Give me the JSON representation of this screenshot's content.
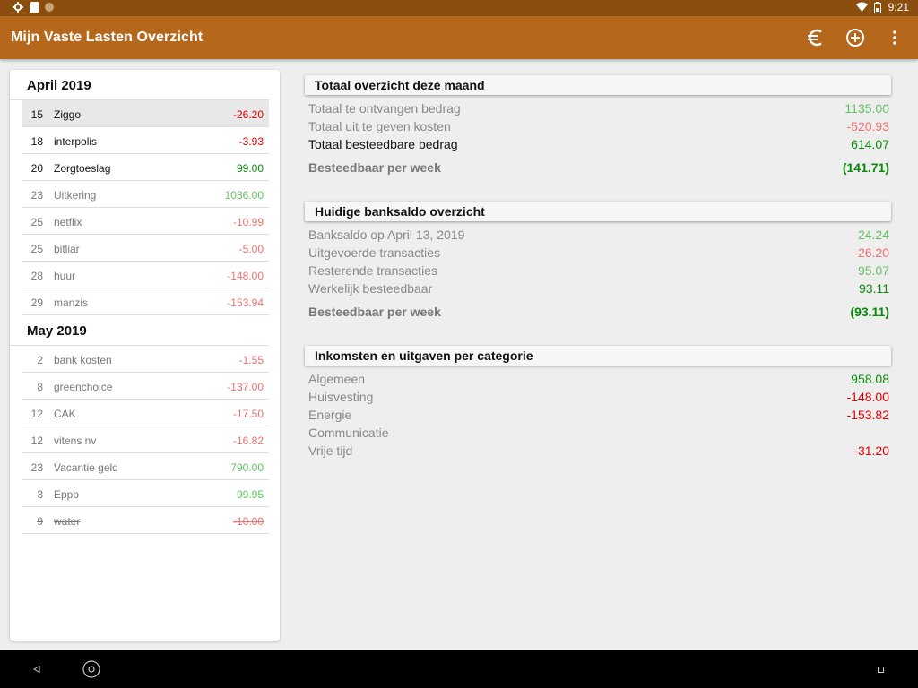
{
  "status_bar": {
    "time": "9:21",
    "icons": [
      "settings-icon",
      "sd-card-icon",
      "notification-dot-icon",
      "wifi-icon",
      "battery-icon"
    ]
  },
  "app_bar": {
    "title": "Mijn Vaste Lasten Overzicht",
    "actions": [
      "euro-icon",
      "add-circle-icon",
      "more-vert-icon"
    ]
  },
  "transactions": [
    {
      "month": "April 2019",
      "items": [
        {
          "day": "15",
          "name": "Ziggo",
          "amount": "-26.20",
          "state": "current",
          "tone": "neg",
          "selected": true
        },
        {
          "day": "18",
          "name": "interpolis",
          "amount": "-3.93",
          "state": "current",
          "tone": "neg"
        },
        {
          "day": "20",
          "name": "Zorgtoeslag",
          "amount": "99.00",
          "state": "current",
          "tone": "pos"
        },
        {
          "day": "23",
          "name": "Uitkering",
          "amount": "1036.00",
          "state": "future",
          "tone": "pos-light"
        },
        {
          "day": "25",
          "name": "netflix",
          "amount": "-10.99",
          "state": "future",
          "tone": "neg-light"
        },
        {
          "day": "25",
          "name": "bitliar",
          "amount": "-5.00",
          "state": "future",
          "tone": "neg-light"
        },
        {
          "day": "28",
          "name": "huur",
          "amount": "-148.00",
          "state": "future",
          "tone": "neg-light"
        },
        {
          "day": "29",
          "name": "manzis",
          "amount": "-153.94",
          "state": "future",
          "tone": "neg-light"
        }
      ]
    },
    {
      "month": "May 2019",
      "items": [
        {
          "day": "2",
          "name": "bank kosten",
          "amount": "-1.55",
          "state": "future",
          "tone": "neg-light"
        },
        {
          "day": "8",
          "name": "greenchoice",
          "amount": "-137.00",
          "state": "future",
          "tone": "neg-light"
        },
        {
          "day": "12",
          "name": "CAK",
          "amount": "-17.50",
          "state": "future",
          "tone": "neg-light"
        },
        {
          "day": "12",
          "name": "vitens nv",
          "amount": "-16.82",
          "state": "future",
          "tone": "neg-light"
        },
        {
          "day": "23",
          "name": "Vacantie geld",
          "amount": "790.00",
          "state": "future",
          "tone": "pos-light"
        },
        {
          "day": "3",
          "name": "Eppo",
          "amount": "99.95",
          "state": "done",
          "tone": "pos-light"
        },
        {
          "day": "9",
          "name": "water",
          "amount": "-10.00",
          "state": "done",
          "tone": "neg-light"
        }
      ]
    }
  ],
  "sections": [
    {
      "title": "Totaal overzicht deze maand",
      "rows": [
        {
          "label": "Totaal te ontvangen bedrag",
          "value": "1135.00",
          "style": "muted",
          "tone": "pos-light"
        },
        {
          "label": "Totaal uit te geven kosten",
          "value": "-520.93",
          "style": "muted",
          "tone": "neg-light"
        },
        {
          "label": "Totaal besteedbare bedrag",
          "value": "614.07",
          "style": "dark",
          "tone": "pos"
        },
        {
          "label": "Besteedbaar per week",
          "value": "(141.71)",
          "style": "bold",
          "tone": "pos"
        }
      ]
    },
    {
      "title": "Huidige banksaldo overzicht",
      "rows": [
        {
          "label": "Banksaldo op April 13, 2019",
          "value": "24.24",
          "style": "muted",
          "tone": "pos-light"
        },
        {
          "label": "Uitgevoerde transacties",
          "value": "-26.20",
          "style": "muted",
          "tone": "neg-light"
        },
        {
          "label": "Resterende transacties",
          "value": "95.07",
          "style": "muted",
          "tone": "pos-light"
        },
        {
          "label": "Werkelijk besteedbaar",
          "value": "93.11",
          "style": "muted",
          "tone": "pos"
        },
        {
          "label": "Besteedbaar per week",
          "value": "(93.11)",
          "style": "bold",
          "tone": "pos"
        }
      ]
    },
    {
      "title": "Inkomsten en uitgaven per categorie",
      "rows": [
        {
          "label": "Algemeen",
          "value": "958.08",
          "style": "muted",
          "tone": "pos"
        },
        {
          "label": "Huisvesting",
          "value": "-148.00",
          "style": "muted",
          "tone": "neg"
        },
        {
          "label": "Energie",
          "value": "-153.82",
          "style": "muted",
          "tone": "neg"
        },
        {
          "label": "Communicatie",
          "value": "",
          "style": "muted",
          "tone": "pos"
        },
        {
          "label": "Vrije tijd",
          "value": "-31.20",
          "style": "muted",
          "tone": "neg"
        }
      ]
    }
  ],
  "nav_bar": {
    "buttons": [
      "back-icon",
      "home-icon",
      "recents-icon"
    ]
  },
  "colors": {
    "app_bar": "#b5671c",
    "status_bar": "#8b4e0f",
    "negative": "#e00000",
    "positive": "#0a8a0a"
  }
}
